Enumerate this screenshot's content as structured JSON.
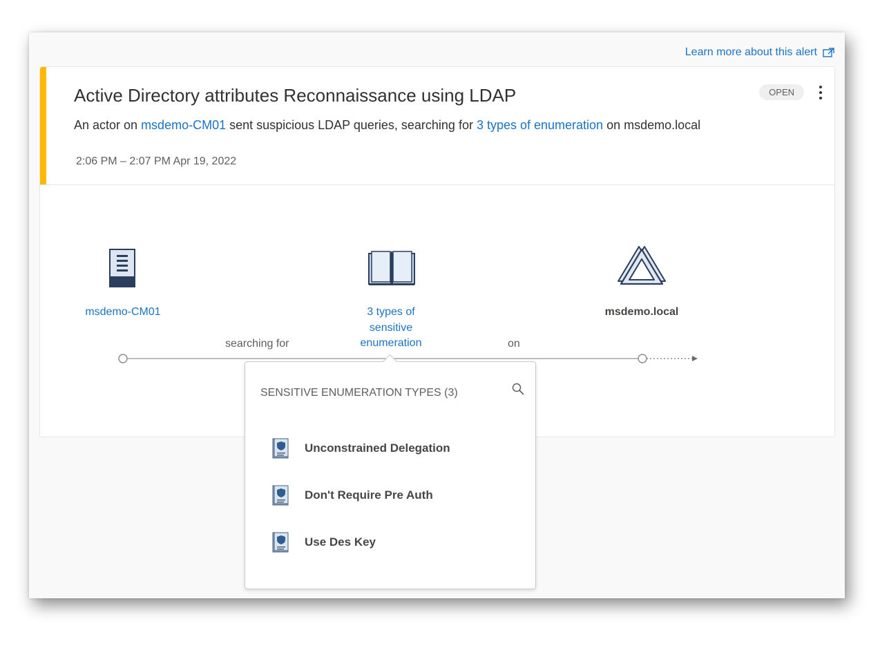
{
  "header_link": {
    "label": "Learn more about this alert",
    "icon": "external-link-icon"
  },
  "alert": {
    "title": "Active Directory attributes Reconnaissance using LDAP",
    "status": "OPEN",
    "description": {
      "prefix": "An actor on ",
      "actor": "msdemo-CM01",
      "middle": " sent suspicious LDAP queries, searching for ",
      "target": "3 types of enumeration",
      "suffix": " on msdemo.local"
    },
    "time_range": "2:06 PM – 2:07 PM Apr 19, 2022",
    "accent_color": "#ffb900"
  },
  "graph": {
    "source": {
      "label": "msdemo-CM01",
      "icon": "computer-icon"
    },
    "middle": {
      "label_line1": "3 types of",
      "label_line2": "sensitive",
      "label_line3": "enumeration",
      "icon": "book-icon"
    },
    "destination": {
      "label": "msdemo.local",
      "icon": "domain-icon"
    },
    "edge1_label": "searching for",
    "edge2_label": "on"
  },
  "popup": {
    "title": "SENSITIVE ENUMERATION TYPES (3)",
    "items": [
      {
        "label": "Unconstrained Delegation",
        "icon": "shield-document-icon"
      },
      {
        "label": "Don't Require Pre Auth",
        "icon": "shield-document-icon"
      },
      {
        "label": "Use Des Key",
        "icon": "shield-document-icon"
      }
    ]
  },
  "colors": {
    "link": "#1a73c7",
    "accent": "#ffb900"
  }
}
